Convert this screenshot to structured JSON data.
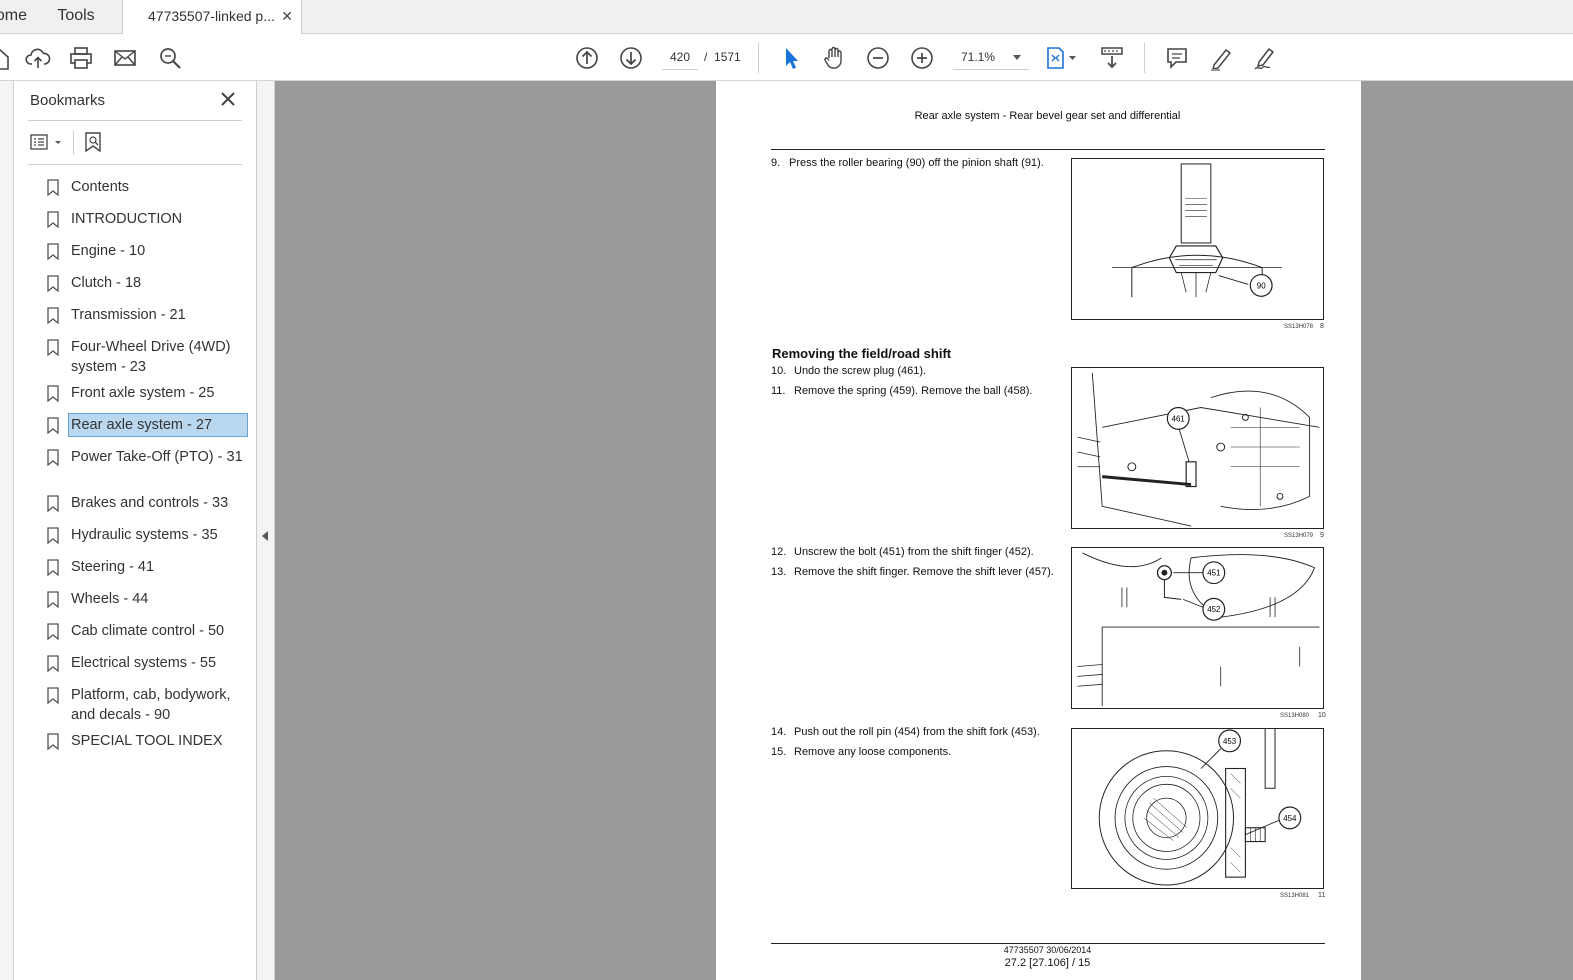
{
  "tabs": {
    "home": "Home",
    "tools": "Tools",
    "document": "47735507-linked p...",
    "close_symbol": "✕"
  },
  "toolbar": {
    "current_page": "420",
    "page_separator": "/",
    "total_pages": "1571",
    "zoom": "71.1%"
  },
  "bookmarks": {
    "title": "Bookmarks",
    "items": [
      {
        "label": "Contents"
      },
      {
        "label": "INTRODUCTION"
      },
      {
        "label": "Engine - 10"
      },
      {
        "label": "Clutch - 18"
      },
      {
        "label": "Transmission - 21"
      },
      {
        "label": "Four-Wheel Drive (4WD) system - 23"
      },
      {
        "label": "Front axle system - 25"
      },
      {
        "label": "Rear axle system - 27",
        "selected": true
      },
      {
        "label": "Power Take-Off (PTO) - 31"
      },
      {
        "label": "Brakes and controls - 33"
      },
      {
        "label": "Hydraulic systems - 35"
      },
      {
        "label": "Steering - 41"
      },
      {
        "label": "Wheels - 44"
      },
      {
        "label": "Cab climate control - 50"
      },
      {
        "label": "Electrical systems - 55"
      },
      {
        "label": "Platform, cab, bodywork, and decals - 90"
      },
      {
        "label": "SPECIAL TOOL INDEX"
      }
    ]
  },
  "document": {
    "header": "Rear axle system - Rear bevel gear set and differential",
    "section_title": "Removing the field/road shift",
    "steps": [
      {
        "n": "9.",
        "text": "Press the roller bearing (90) off the pinion shaft (91)."
      },
      {
        "n": "10.",
        "text": "Undo the screw plug (461)."
      },
      {
        "n": "11.",
        "text": "Remove the spring (459). Remove the ball (458)."
      },
      {
        "n": "12.",
        "text": "Unscrew the bolt (451) from the shift finger (452)."
      },
      {
        "n": "13.",
        "text": "Remove the shift finger. Remove the shift lever (457)."
      },
      {
        "n": "14.",
        "text": "Push out the roll pin (454) from the shift fork (453)."
      },
      {
        "n": "15.",
        "text": "Remove any loose components."
      }
    ],
    "figures": [
      {
        "ref": "SS13H078",
        "num": "8",
        "callouts": [
          "90"
        ]
      },
      {
        "ref": "SS13H079",
        "num": "9",
        "callouts": [
          "461"
        ]
      },
      {
        "ref": "SS13H080",
        "num": "10",
        "callouts": [
          "451",
          "452"
        ]
      },
      {
        "ref": "SS13H081",
        "num": "11",
        "callouts": [
          "453",
          "454"
        ]
      }
    ],
    "footer_line1": "47735507 30/06/2014",
    "footer_line2": "27.2 [27.106] / 15"
  },
  "icons": {
    "toolbar": [
      "home-icon",
      "upload-icon",
      "print-icon",
      "email-icon",
      "zoom-search-icon",
      "arrow-up-icon",
      "arrow-down-icon",
      "select-cursor-icon",
      "hand-icon",
      "zoom-out-icon",
      "zoom-in-icon",
      "fit-page-icon",
      "scroll-mode-icon",
      "comment-icon",
      "highlight-pen-icon",
      "sign-icon"
    ],
    "accent": "#1a73d9",
    "selection_fill": "#b9d7ef"
  }
}
